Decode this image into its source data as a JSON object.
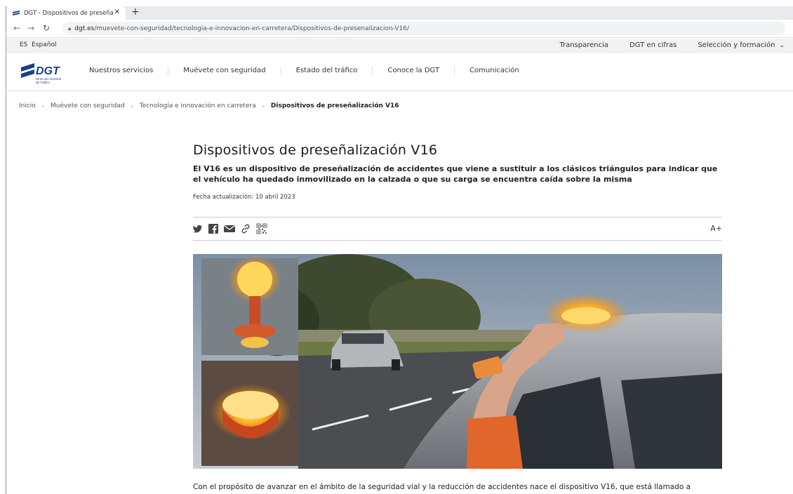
{
  "browser": {
    "tab_title": "DGT - Dispositivos de preseñaliz",
    "url_host": "dgt.es",
    "url_path": "/muevete-con-seguridad/tecnologia-e-innovacion-en-carretera/Dispositivos-de-presenalizacion-V16/"
  },
  "utility": {
    "lang_code": "ES",
    "lang_label": "Español",
    "links": [
      "Transparencia",
      "DGT en cifras",
      "Selección y formación"
    ]
  },
  "header": {
    "logo_text": "DGT",
    "logo_subtext_1": "Dirección General",
    "logo_subtext_2": "de Tráfico",
    "nav": [
      "Nuestros servicios",
      "Muévete con seguridad",
      "Estado del tráfico",
      "Conoce la DGT",
      "Comunicación"
    ]
  },
  "breadcrumb": {
    "items": [
      "Inicio",
      "Muévete con seguridad",
      "Tecnología e innovación en carretera"
    ],
    "current": "Dispositivos de preseñalización V16"
  },
  "article": {
    "title": "Dispositivos de preseñalización V16",
    "lead": "El V16 es un dispositivo de preseñalización de accidentes que viene a sustituir a los clásicos triángulos para indicar que el vehículo ha quedado inmovilizado en la calzada o que su carga se encuentra caída sobre la misma",
    "date": "Fecha actualización: 10 abril 2023",
    "font_size_control": "A+",
    "body_start": "Con el propósito de avanzar en el ámbito de la seguridad vial y la reducción de accidentes nace el dispositivo V16, que está llamado a"
  },
  "colors": {
    "brand_blue": "#1a3f8f",
    "utility_bg": "#f2f2f2",
    "light_amber": "#ffb020"
  },
  "icons": {
    "share": [
      "twitter-icon",
      "facebook-icon",
      "email-icon",
      "link-icon",
      "qr-code-icon"
    ]
  }
}
